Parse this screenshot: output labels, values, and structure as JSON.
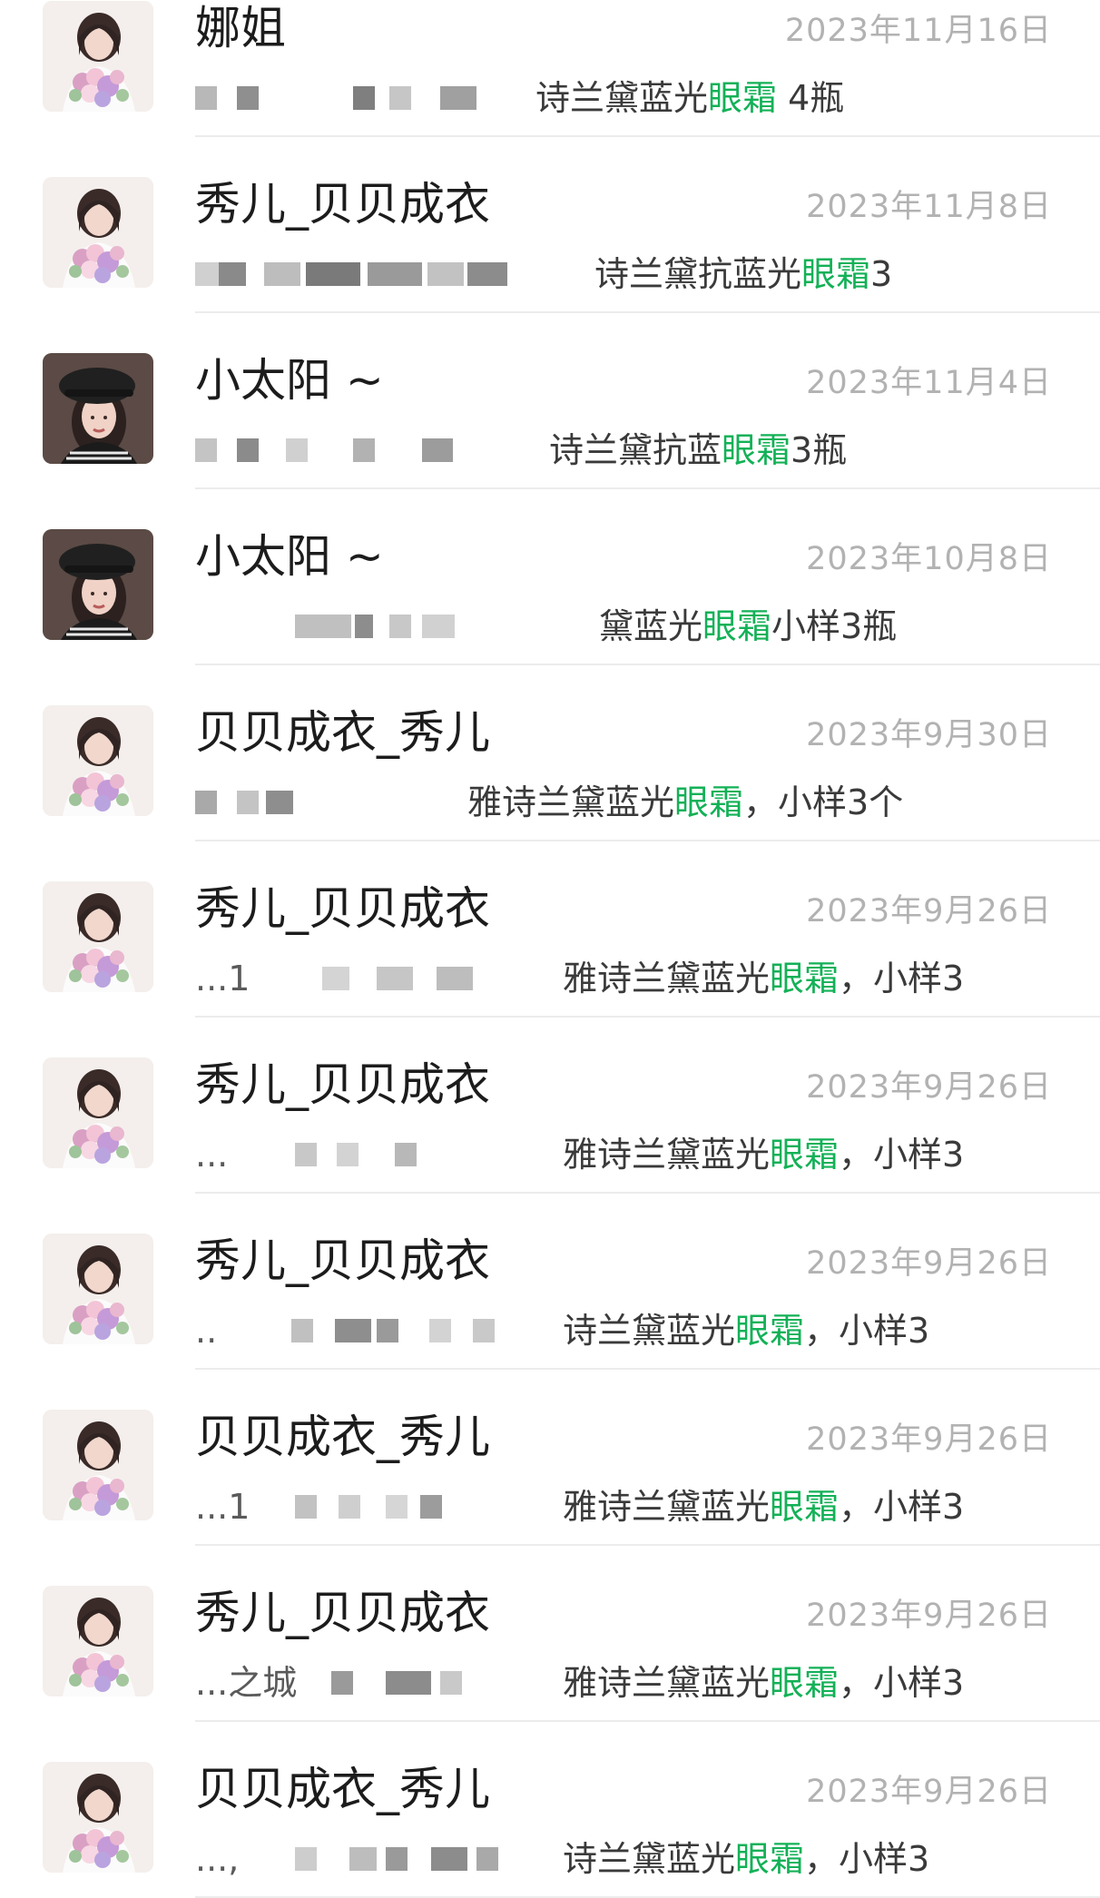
{
  "colors": {
    "highlight": "#13b157",
    "name": "#1c1c1c",
    "date": "#b2b2b2",
    "preview": "#3a3a3a",
    "divider": "#ececec"
  },
  "results": [
    {
      "name": "娜姐",
      "date": "2023年11月16日",
      "lead": "",
      "text": "诗兰黛蓝光",
      "highlight": "眼霜",
      "suffix": " 4瓶",
      "avatar": "flowers"
    },
    {
      "name": "秀儿_贝贝成衣",
      "date": "2023年11月8日",
      "lead": "",
      "text": "诗兰黛抗蓝光",
      "highlight": "眼霜",
      "suffix": "3",
      "avatar": "flowers"
    },
    {
      "name": "小太阳 ~",
      "date": "2023年11月4日",
      "lead": "",
      "text": "诗兰黛抗蓝",
      "highlight": "眼霜",
      "suffix": "3瓶",
      "avatar": "beret"
    },
    {
      "name": "小太阳 ~",
      "date": "2023年10月8日",
      "lead": "",
      "text": "黛蓝光",
      "highlight": "眼霜",
      "suffix": "小样3瓶",
      "avatar": "beret"
    },
    {
      "name": "贝贝成衣_秀儿",
      "date": "2023年9月30日",
      "lead": "",
      "text": "雅诗兰黛蓝光",
      "highlight": "眼霜",
      "suffix": "，小样3个",
      "avatar": "flowers"
    },
    {
      "name": "秀儿_贝贝成衣",
      "date": "2023年9月26日",
      "lead": "...1",
      "text": "雅诗兰黛蓝光",
      "highlight": "眼霜",
      "suffix": "，小样3",
      "avatar": "flowers"
    },
    {
      "name": "秀儿_贝贝成衣",
      "date": "2023年9月26日",
      "lead": "...",
      "text": "雅诗兰黛蓝光",
      "highlight": "眼霜",
      "suffix": "，小样3",
      "avatar": "flowers"
    },
    {
      "name": "秀儿_贝贝成衣",
      "date": "2023年9月26日",
      "lead": "..",
      "text": "诗兰黛蓝光",
      "highlight": "眼霜",
      "suffix": "，小样3",
      "avatar": "flowers"
    },
    {
      "name": "贝贝成衣_秀儿",
      "date": "2023年9月26日",
      "lead": "...1",
      "text": "雅诗兰黛蓝光",
      "highlight": "眼霜",
      "suffix": "，小样3",
      "avatar": "flowers"
    },
    {
      "name": "秀儿_贝贝成衣",
      "date": "2023年9月26日",
      "lead": "...之城",
      "text": "雅诗兰黛蓝光",
      "highlight": "眼霜",
      "suffix": "，小样3",
      "avatar": "flowers"
    },
    {
      "name": "贝贝成衣_秀儿",
      "date": "2023年9月26日",
      "lead": "...,",
      "text": "诗兰黛蓝光",
      "highlight": "眼霜",
      "suffix": "，小样3",
      "avatar": "flowers"
    }
  ]
}
